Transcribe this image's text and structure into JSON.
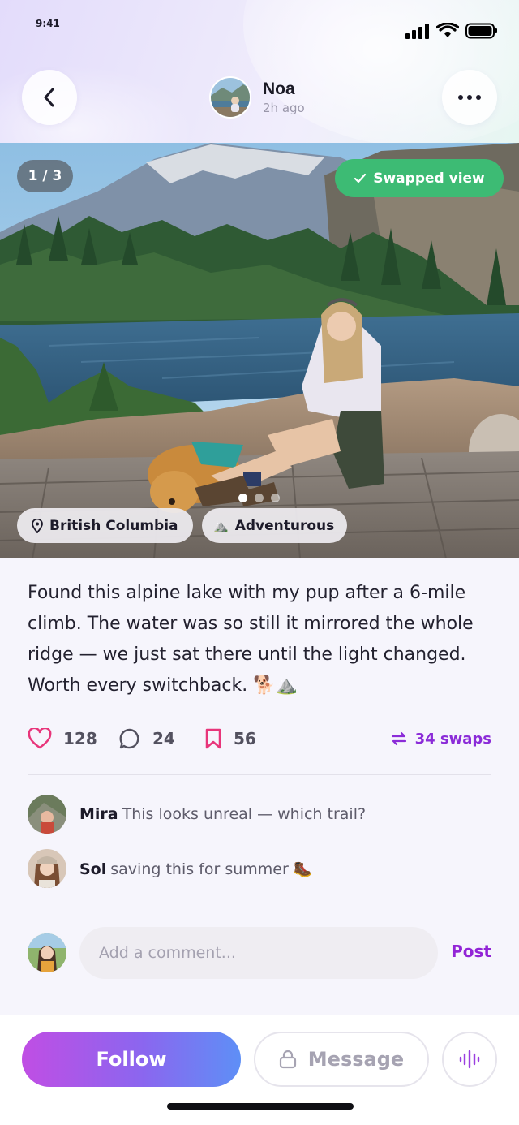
{
  "status_bar": {
    "time": "9:41"
  },
  "header": {
    "author_name": "Noa",
    "post_time": "2h ago"
  },
  "photo": {
    "counter": "1 / 3",
    "swapped_label": "Swapped view",
    "location_tag": "British Columbia",
    "mood_tag": "Adventurous",
    "mood_emoji": "⛰️",
    "page_count": 3,
    "active_page": 1
  },
  "post": {
    "caption": "Found this alpine lake with my pup after a 6-mile climb. The water was so still it mirrored the whole ridge — we just sat there until the light changed. Worth every switchback. 🐕⛰️"
  },
  "stats": {
    "likes": "128",
    "comments": "24",
    "saves": "56",
    "swaps": "34 swaps"
  },
  "comments": [
    {
      "user": "Mira",
      "text": "This looks unreal — which trail?"
    },
    {
      "user": "Sol",
      "text": "saving this for summer 🥾"
    }
  ],
  "comment_input": {
    "placeholder": "Add a comment...",
    "post_label": "Post"
  },
  "actions": {
    "follow_label": "Follow",
    "message_label": "Message"
  },
  "colors": {
    "accent_purple": "#8b2bd8",
    "like_pink": "#e8357a",
    "swapped_green": "#3dbb74",
    "follow_gradient_start": "#c04ee4",
    "follow_gradient_end": "#5e8ff6"
  },
  "icons": [
    "back-icon",
    "more-icon",
    "check-icon",
    "pin-icon",
    "heart-icon",
    "comment-icon",
    "bookmark-icon",
    "swap-icon",
    "lock-icon",
    "voice-icon",
    "signal-icon",
    "wifi-icon",
    "battery-icon"
  ]
}
